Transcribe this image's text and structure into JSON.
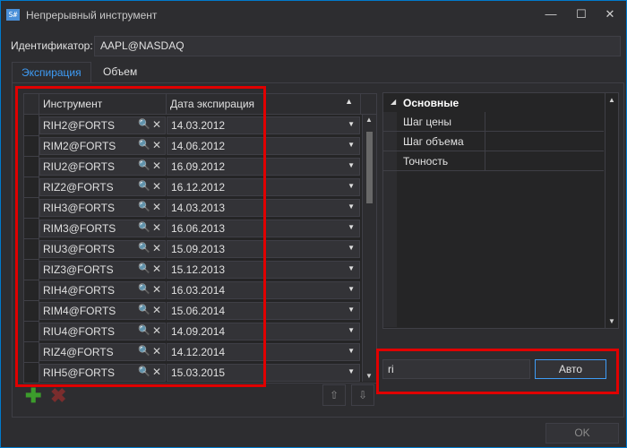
{
  "window": {
    "app_icon": "S#",
    "title": "Непрерывный инструмент",
    "minimize_glyph": "—",
    "maximize_glyph": "☐",
    "close_glyph": "✕"
  },
  "identifier": {
    "label": "Идентификатор:",
    "value": "AAPL@NASDAQ"
  },
  "tabs": [
    {
      "label": "Экспирация",
      "active": true
    },
    {
      "label": "Объем",
      "active": false
    }
  ],
  "grid": {
    "columns": [
      "Инструмент",
      "Дата экспирация"
    ],
    "sort_glyph": "▲",
    "search_glyph": "🔍",
    "clear_glyph": "✕",
    "dropdown_glyph": "▼",
    "rows": [
      {
        "instrument": "RIH2@FORTS",
        "date": "14.03.2012"
      },
      {
        "instrument": "RIM2@FORTS",
        "date": "14.06.2012"
      },
      {
        "instrument": "RIU2@FORTS",
        "date": "16.09.2012"
      },
      {
        "instrument": "RIZ2@FORTS",
        "date": "16.12.2012"
      },
      {
        "instrument": "RIH3@FORTS",
        "date": "14.03.2013"
      },
      {
        "instrument": "RIM3@FORTS",
        "date": "16.06.2013"
      },
      {
        "instrument": "RIU3@FORTS",
        "date": "15.09.2013"
      },
      {
        "instrument": "RIZ3@FORTS",
        "date": "15.12.2013"
      },
      {
        "instrument": "RIH4@FORTS",
        "date": "16.03.2014"
      },
      {
        "instrument": "RIM4@FORTS",
        "date": "15.06.2014"
      },
      {
        "instrument": "RIU4@FORTS",
        "date": "14.09.2014"
      },
      {
        "instrument": "RIZ4@FORTS",
        "date": "14.12.2014"
      },
      {
        "instrument": "RIH5@FORTS",
        "date": "15.03.2015"
      }
    ],
    "scroll_up_glyph": "▲",
    "scroll_down_glyph": "▼"
  },
  "toolbar": {
    "add_glyph": "✚",
    "delete_glyph": "✖",
    "move_up_glyph": "⇧",
    "move_down_glyph": "⇩"
  },
  "properties": {
    "category": "Основные",
    "category_glyph": "◢",
    "items": [
      "Шаг цены",
      "Шаг объема",
      "Точность"
    ],
    "scroll_up_glyph": "▲",
    "scroll_down_glyph": "▼"
  },
  "filter": {
    "value": "ri",
    "auto_label": "Авто"
  },
  "footer": {
    "ok_label": "OK"
  },
  "colors": {
    "accent": "#007acc",
    "tab_active_text": "#3e9cf6",
    "highlight": "#e00000",
    "add_icon": "#3c9c2c",
    "delete_icon": "#7a2d2d"
  }
}
